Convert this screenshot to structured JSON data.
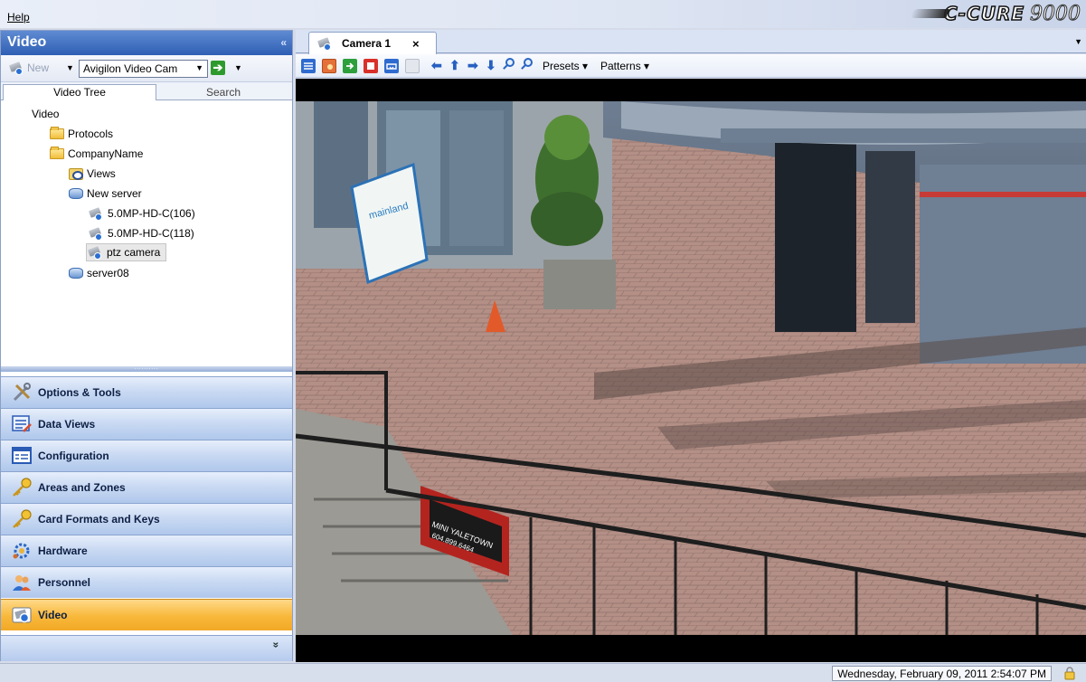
{
  "menu": {
    "help": "Help"
  },
  "brand": {
    "name": "C-CURE",
    "version": "9000"
  },
  "left_pane": {
    "title": "Video",
    "collapse_glyph": "«",
    "toolbar": {
      "new_label": "New",
      "camera_select_value": "Avigilon Video Cam"
    },
    "tabs": [
      {
        "label": "Video Tree",
        "active": true
      },
      {
        "label": "Search",
        "active": false
      }
    ],
    "tree": [
      {
        "label": "Video",
        "icon": "none",
        "level": 0
      },
      {
        "label": "Protocols",
        "icon": "folder-icon",
        "level": 1
      },
      {
        "label": "CompanyName",
        "icon": "folder-icon",
        "level": 1
      },
      {
        "label": "Views",
        "icon": "views-icon",
        "level": 2
      },
      {
        "label": "New server",
        "icon": "server-icon",
        "level": 2
      },
      {
        "label": "5.0MP-HD-C(106)",
        "icon": "camera-icon",
        "level": 3
      },
      {
        "label": "5.0MP-HD-C(118)",
        "icon": "camera-icon",
        "level": 3
      },
      {
        "label": "ptz camera",
        "icon": "camera-icon",
        "level": 3,
        "selected": true
      },
      {
        "label": "server08",
        "icon": "server-icon",
        "level": 2
      }
    ],
    "nav": [
      {
        "label": "Options & Tools",
        "icon": "tools-icon"
      },
      {
        "label": "Data Views",
        "icon": "data-views-icon"
      },
      {
        "label": "Configuration",
        "icon": "configuration-icon"
      },
      {
        "label": "Areas and Zones",
        "icon": "key-icon"
      },
      {
        "label": "Card Formats and Keys",
        "icon": "key-icon"
      },
      {
        "label": "Hardware",
        "icon": "hardware-icon"
      },
      {
        "label": "Personnel",
        "icon": "personnel-icon"
      },
      {
        "label": "Video",
        "icon": "camera-icon",
        "active": true
      }
    ],
    "more_glyph": "»"
  },
  "document": {
    "tab": {
      "label": "Camera 1",
      "close_glyph": "×"
    },
    "toolbar": {
      "presets": "Presets",
      "patterns": "Patterns"
    }
  },
  "status": {
    "datetime": "Wednesday, February 09, 2011 2:54:07 PM"
  },
  "colors": {
    "header_blue": "#2f5fb4",
    "active_nav": "#f8b83a",
    "nav_blue": "#c7d8f2"
  }
}
